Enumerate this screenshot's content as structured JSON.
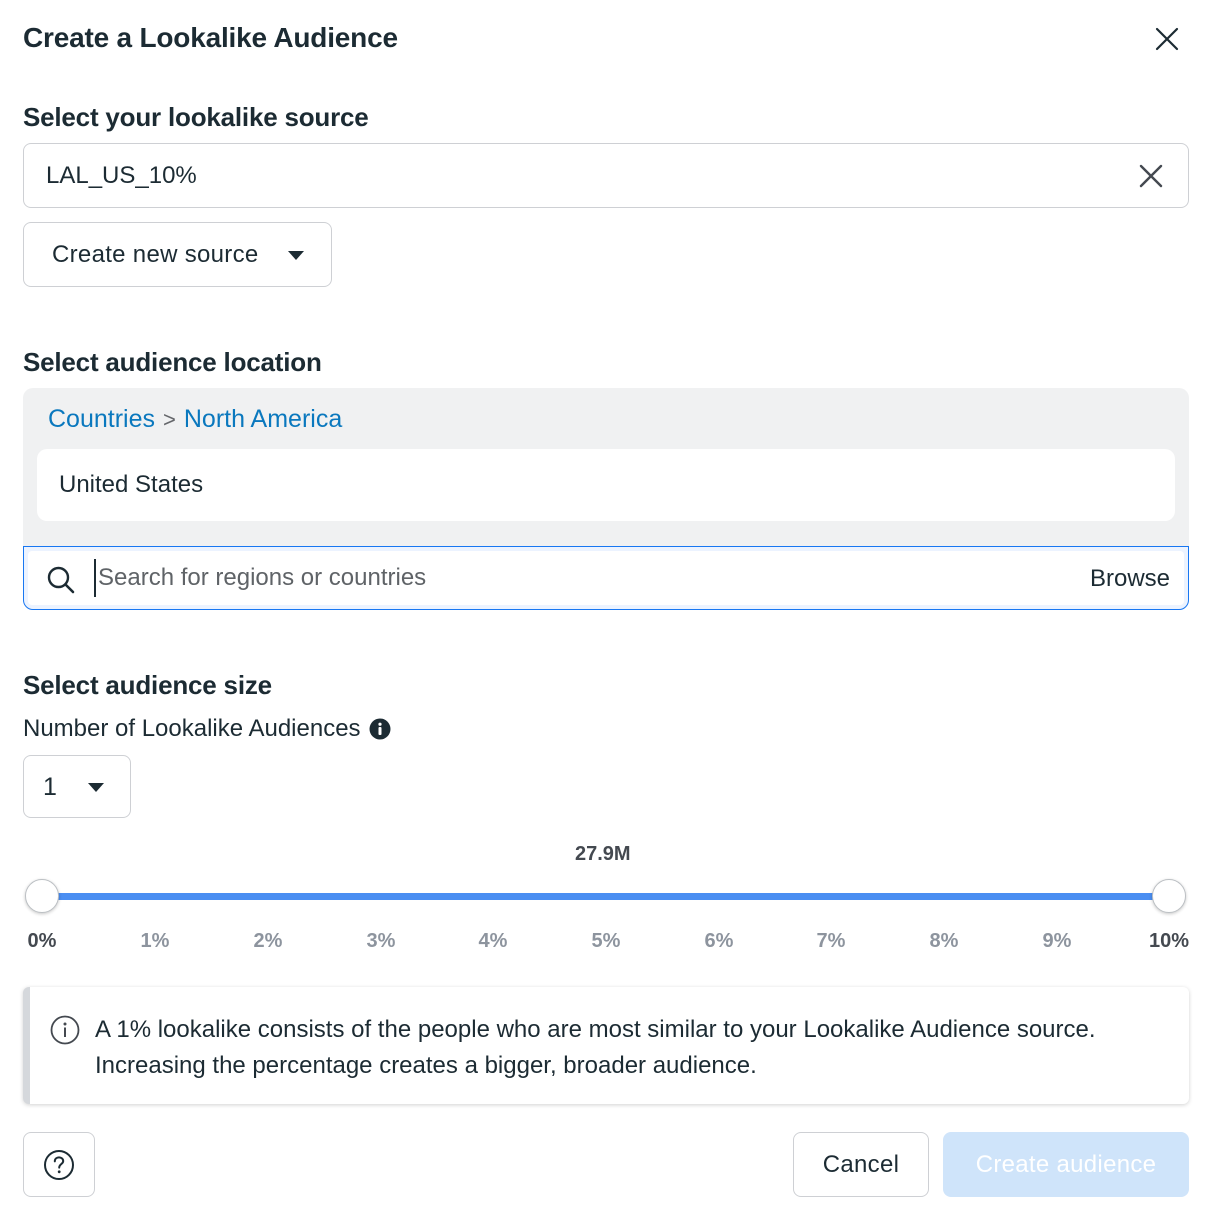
{
  "dialog": {
    "title": "Create a Lookalike Audience",
    "close_icon": "close-icon"
  },
  "source": {
    "heading": "Select your lookalike source",
    "selected_value": "LAL_US_10%",
    "clear_icon": "clear-icon",
    "new_source_label": "Create new source"
  },
  "location": {
    "heading": "Select audience location",
    "breadcrumb": [
      "Countries",
      ">",
      "North America"
    ],
    "selected_country": "United States",
    "search_placeholder": "Search for regions or countries",
    "browse_label": "Browse",
    "search_icon": "search-icon"
  },
  "size": {
    "heading": "Select audience size",
    "count_label": "Number of Lookalike Audiences",
    "count_value": "1",
    "estimated_size": "27.9M",
    "range_start_percent": 0,
    "range_end_percent": 10,
    "ticks": [
      "0%",
      "1%",
      "2%",
      "3%",
      "4%",
      "5%",
      "6%",
      "7%",
      "8%",
      "9%",
      "10%"
    ]
  },
  "notice": {
    "text": "A 1% lookalike consists of the people who are most similar to your Lookalike Audience source. Increasing the percentage creates a bigger, broader audience.",
    "icon": "info-icon"
  },
  "footer": {
    "help_icon": "question-icon",
    "cancel_label": "Cancel",
    "create_label": "Create audience"
  },
  "colors": {
    "accent": "#1877f2",
    "link": "#0a78be",
    "slider_track": "#4a8ef2",
    "disabled_button": "#cfe4fa",
    "text": "#1c2b33"
  }
}
